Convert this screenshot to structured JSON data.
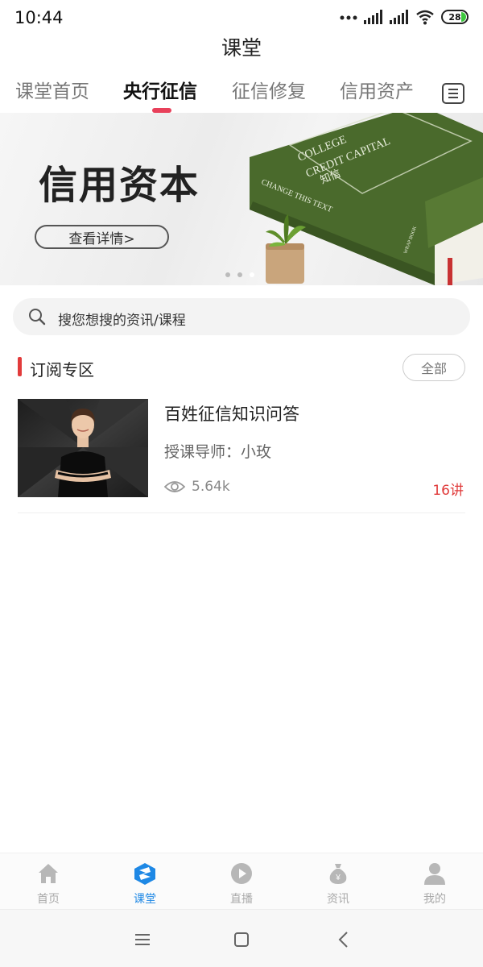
{
  "status_bar": {
    "time": "10:44",
    "battery": "28"
  },
  "header": {
    "title": "课堂"
  },
  "tabs": [
    {
      "label": "课堂首页"
    },
    {
      "label": "央行征信"
    },
    {
      "label": "征信修复"
    },
    {
      "label": "信用资产"
    }
  ],
  "active_tab": "央行征信",
  "banner": {
    "title": "信用资本",
    "button_label": "查看详情>",
    "book_text_1": "COLLEGE",
    "book_text_2": "CREDIT CAPITAL",
    "book_text_3": "知信",
    "book_spine": "CHANGE THIS TEXT",
    "book_bottom": "WRAP BOOK",
    "slide_count": 3,
    "active_slide": 3
  },
  "search": {
    "placeholder": "搜您想搜的资讯/课程"
  },
  "section": {
    "title": "订阅专区",
    "all_label": "全部"
  },
  "courses": [
    {
      "title": "百姓征信知识问答",
      "teacher": "授课导师：小玫",
      "views": "5.64k",
      "lessons": "16讲"
    }
  ],
  "bottom_nav": [
    {
      "label": "首页",
      "icon": "home-icon"
    },
    {
      "label": "课堂",
      "icon": "classroom-icon"
    },
    {
      "label": "直播",
      "icon": "live-play-icon"
    },
    {
      "label": "资讯",
      "icon": "news-moneybag-icon"
    },
    {
      "label": "我的",
      "icon": "profile-icon"
    }
  ],
  "active_nav": "课堂",
  "colors": {
    "accent_red": "#e23b3b",
    "tab_underline": "#e8405a",
    "active_blue": "#1e88e5",
    "book_green": "#4a6a2c"
  }
}
